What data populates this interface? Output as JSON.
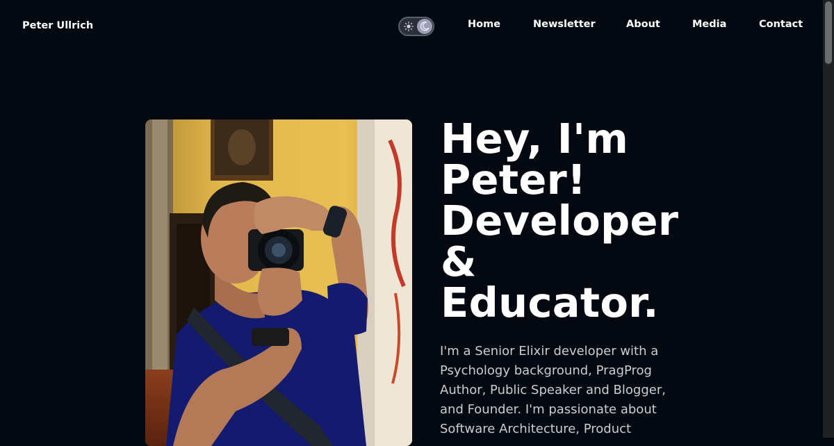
{
  "header": {
    "site_name": "Peter Ullrich",
    "theme_toggle": {
      "icons": [
        "sun-icon",
        "moon-icon"
      ],
      "active": "dark"
    },
    "nav": [
      "Home",
      "Newsletter",
      "About",
      "Media",
      "Contact"
    ]
  },
  "hero": {
    "photo": {
      "icon": "photographer-portrait"
    },
    "headline": [
      "Hey, I'm",
      "Peter!",
      "Developer",
      "&",
      "Educator."
    ],
    "intro": [
      "I'm a Senior Elixir developer with a",
      "Psychology background, PragProg",
      "Author, Public Speaker and Blogger,",
      "and Founder. I'm passionate about",
      "Software Architecture, Product"
    ]
  },
  "colors": {
    "background": "#040811",
    "text": "#ffffff",
    "body_text": "#c9cdd4",
    "toggle_bg": "#2a2f3a",
    "toggle_knob": "#9e9eb6"
  }
}
